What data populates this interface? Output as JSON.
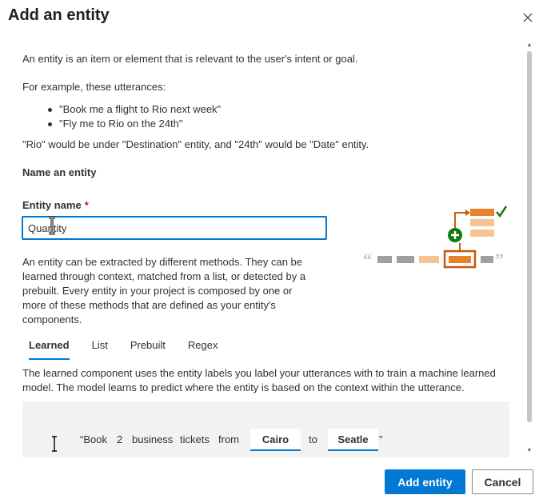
{
  "dialog": {
    "title": "Add an entity",
    "close_icon": "close-icon"
  },
  "intro": {
    "definition": "An entity is an item or element that is relevant to the user's intent or goal.",
    "example_lead": "For example, these utterances:",
    "examples": [
      "\"Book me a flight to Rio next week\"",
      "\"Fly me to Rio on the 24th\""
    ],
    "explanation": "\"Rio\" would be under \"Destination\" entity, and \"24th\" would be \"Date\" entity."
  },
  "name_section": {
    "title": "Name an entity",
    "field_label": "Entity name",
    "required_mark": "*",
    "field_value": "Quantity"
  },
  "methods": {
    "description": "An entity can be extracted by different methods. They can be learned through context, matched from a list, or detected by a prebuilt. Every entity in your project is composed by one or more of these methods that are defined as your entity's components."
  },
  "tabs": {
    "items": [
      "Learned",
      "List",
      "Prebuilt",
      "Regex"
    ],
    "selected": "Learned"
  },
  "learned": {
    "description": "The learned component uses the entity labels you label your utterances with to train a machine learned model. The model learns to predict where the entity is based on the context within the utterance.",
    "example": {
      "open_quote": "“Book",
      "w2": "2",
      "w3": "business",
      "w4": "tickets",
      "w5": "from",
      "entity1": "Cairo",
      "w6": "to",
      "entity2": "Seatle",
      "close_quote": "”"
    }
  },
  "footer": {
    "primary_label": "Add entity",
    "secondary_label": "Cancel"
  },
  "colors": {
    "accent": "#0078d4",
    "required": "#a4262c",
    "illustration_orange": "#e8822a",
    "illustration_green": "#107c10"
  }
}
